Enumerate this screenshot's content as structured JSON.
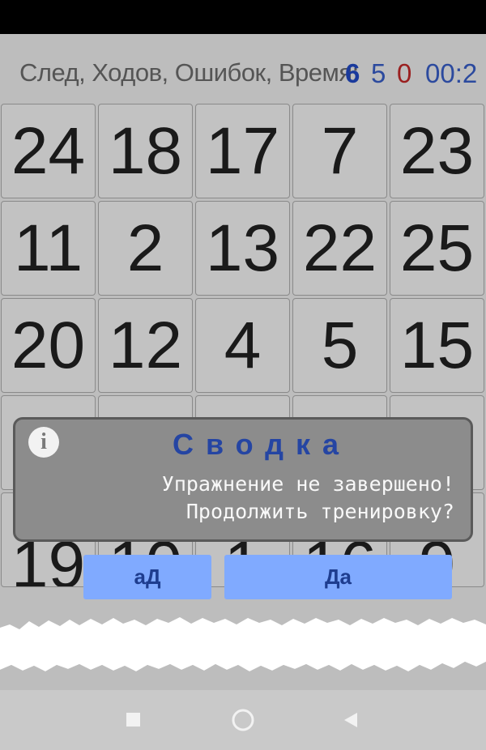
{
  "stats": {
    "label": "След, Ходов, Ошибок, Время:",
    "next": "6",
    "moves": "5",
    "errors": "0",
    "time": "00:2"
  },
  "grid": [
    [
      "24",
      "18",
      "17",
      "7",
      "23"
    ],
    [
      "11",
      "2",
      "13",
      "22",
      "25"
    ],
    [
      "20",
      "12",
      "4",
      "5",
      "15"
    ],
    [
      "",
      "",
      "",
      "",
      ""
    ],
    [
      "19",
      "10",
      "1",
      "16",
      "9"
    ]
  ],
  "dialog": {
    "icon": "info-icon",
    "title": "Сводка",
    "message_line1": "Упражнение не завершено!",
    "message_line2": "Продолжить тренировку?",
    "btn_left": "аД",
    "btn_right": "Да"
  },
  "nav": {
    "icons": [
      "recents-square-icon",
      "home-circle-icon",
      "back-triangle-icon"
    ]
  },
  "colors": {
    "next": "#1a3a9c",
    "moves": "#2c4a9e",
    "errors": "#9a1f1f",
    "time": "#2c4a9e",
    "button": "#80aaff",
    "dialog_title": "#2545a3"
  }
}
